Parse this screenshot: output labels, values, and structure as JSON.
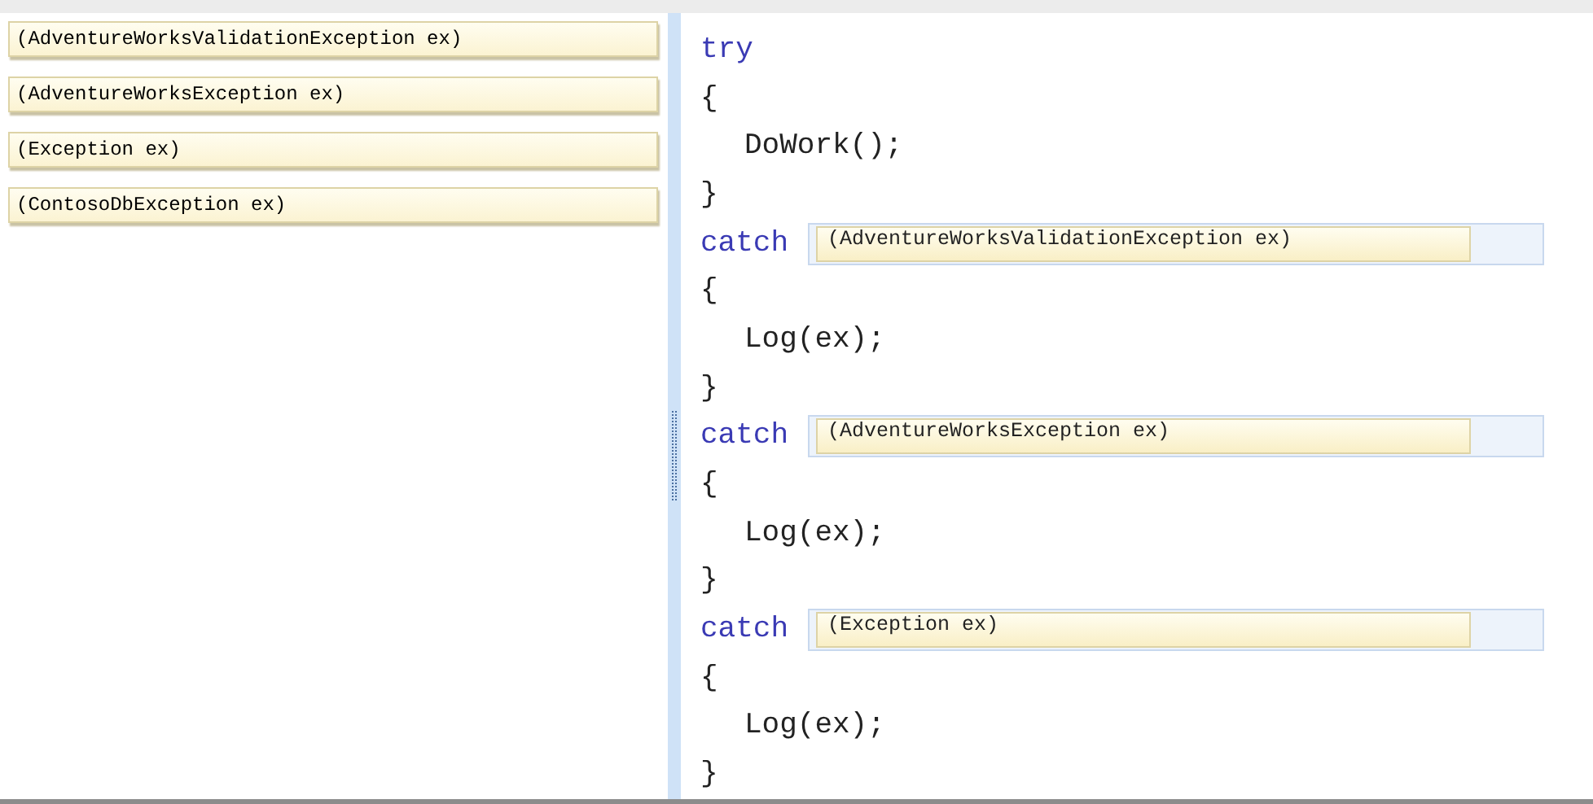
{
  "source_items": [
    "(AdventureWorksValidationException ex)",
    "(AdventureWorksException ex)",
    "(Exception ex)",
    "(ContosoDbException ex)"
  ],
  "code_lines": [
    {
      "kind": "keyword",
      "text": "try"
    },
    {
      "kind": "brace",
      "text": "{"
    },
    {
      "kind": "statement",
      "text": "DoWork();"
    },
    {
      "kind": "brace",
      "text": "}"
    },
    {
      "kind": "catch",
      "text": "catch",
      "answer": "(AdventureWorksValidationException ex)"
    },
    {
      "kind": "brace",
      "text": "{"
    },
    {
      "kind": "statement",
      "text": "Log(ex);"
    },
    {
      "kind": "brace",
      "text": "}"
    },
    {
      "kind": "catch",
      "text": "catch",
      "answer": "(AdventureWorksException ex)"
    },
    {
      "kind": "brace",
      "text": "{"
    },
    {
      "kind": "statement",
      "text": "Log(ex);"
    },
    {
      "kind": "brace",
      "text": "}"
    },
    {
      "kind": "catch",
      "text": "catch",
      "answer": "(Exception ex)"
    },
    {
      "kind": "brace",
      "text": "{"
    },
    {
      "kind": "statement",
      "text": "Log(ex);"
    },
    {
      "kind": "brace",
      "text": "}"
    }
  ]
}
